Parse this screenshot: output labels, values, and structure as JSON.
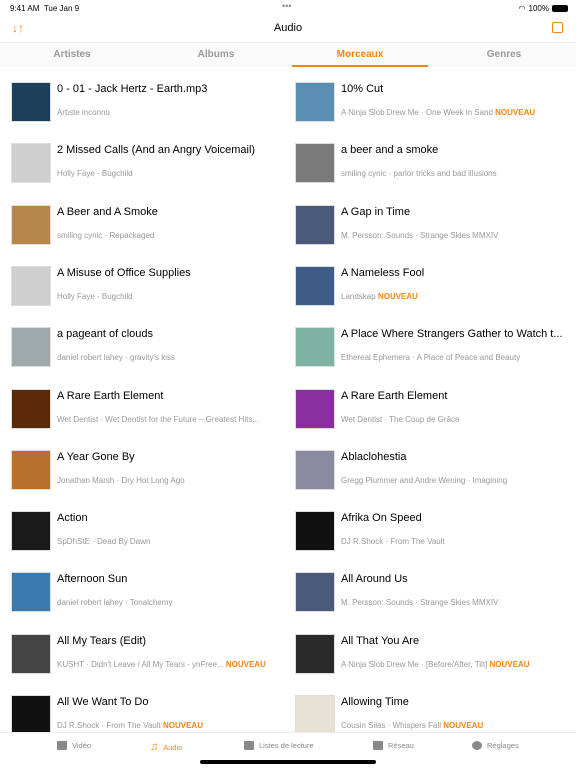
{
  "status": {
    "time": "9:41 AM",
    "date": "Tue Jan 9",
    "battery": "100%"
  },
  "nav": {
    "title": "Audio"
  },
  "segments": [
    {
      "label": "Artistes"
    },
    {
      "label": "Albums"
    },
    {
      "label": "Morceaux",
      "active": true
    },
    {
      "label": "Genres"
    }
  ],
  "new_label": "NOUVEAU",
  "tracks": [
    {
      "title": "0 - 01 - Jack Hertz - Earth.mp3",
      "subtitle": "Artiste inconnu",
      "new": false,
      "thumb": "#1d3f5a"
    },
    {
      "title": "10% Cut",
      "subtitle": "A Ninja Slob Drew Me · One Week in Sand",
      "new": true,
      "thumb": "#5a8fb3"
    },
    {
      "title": "2 Missed Calls (And an Angry Voicemail)",
      "subtitle": "Holly Faye · Bugchild",
      "new": false,
      "thumb": "#cfcfcf"
    },
    {
      "title": "a beer and a smoke",
      "subtitle": "smiling cynic · parlor tricks and bad illusions",
      "new": false,
      "thumb": "#7a7a7a"
    },
    {
      "title": "A Beer and A Smoke",
      "subtitle": "smiling cynic · Repackaged",
      "new": false,
      "thumb": "#b7864b"
    },
    {
      "title": "A Gap in Time",
      "subtitle": "M. Persson: Sounds · Strange Skies MMXIV",
      "new": false,
      "thumb": "#4a5a7a"
    },
    {
      "title": "A Misuse of Office Supplies",
      "subtitle": "Holly Faye · Bugchild",
      "new": false,
      "thumb": "#cfcfcf"
    },
    {
      "title": "A Nameless Fool",
      "subtitle": "Landskap",
      "new": true,
      "thumb": "#3e5c86"
    },
    {
      "title": "a pageant of clouds",
      "subtitle": "daniel robert lahey · gravity's kiss",
      "new": false,
      "thumb": "#9fa8ad"
    },
    {
      "title": "A Place Where Strangers Gather to Watch t...",
      "subtitle": "Ethereal Ephemera · A Place of Peace and Beauty",
      "new": false,
      "thumb": "#7fb3a4"
    },
    {
      "title": "A Rare Earth Element",
      "subtitle": "Wet Dentist · Wet Dentist for the Future – Greatest Hits...",
      "new": false,
      "thumb": "#5a2a0a"
    },
    {
      "title": "A Rare Earth Element",
      "subtitle": "Wet Dentist · The Coup de Grâce",
      "new": false,
      "thumb": "#8a2fa0"
    },
    {
      "title": "A Year Gone By",
      "subtitle": "Jonathan Marsh · Dry Hot Long Ago",
      "new": false,
      "thumb": "#b8702e"
    },
    {
      "title": "Ablaclohestia",
      "subtitle": "Gregg Plummer and Andre Wening · Imagining",
      "new": false,
      "thumb": "#8a8aa0"
    },
    {
      "title": "Action",
      "subtitle": "SpDhStE · Dead By Dawn",
      "new": false,
      "thumb": "#1a1a1a"
    },
    {
      "title": "Afrika On Speed",
      "subtitle": "DJ R.Shock · From The Vault",
      "new": false,
      "thumb": "#111"
    },
    {
      "title": "Afternoon Sun",
      "subtitle": "daniel robert lahey · Tonalchemy",
      "new": false,
      "thumb": "#3a7ab0"
    },
    {
      "title": "All Around Us",
      "subtitle": "M. Persson: Sounds · Strange Skies MMXIV",
      "new": false,
      "thumb": "#4a5a7a"
    },
    {
      "title": "All My Tears (Edit)",
      "subtitle": "KUSHT · Didn't Leave / All My Tears - ynFree...",
      "new": true,
      "thumb": "#444"
    },
    {
      "title": "All That You Are",
      "subtitle": "A Ninja Slob Drew Me · [Before/After, Tilt]",
      "new": true,
      "thumb": "#2a2a2a"
    },
    {
      "title": "All We Want To Do",
      "subtitle": "DJ R.Shock · From The Vault",
      "new": true,
      "thumb": "#111"
    },
    {
      "title": "Allowing Time",
      "subtitle": "Cousin Silas · Whispers Fall",
      "new": true,
      "thumb": "#e8e2d6"
    }
  ],
  "tabs": [
    {
      "label": "Vidéo"
    },
    {
      "label": "Audio",
      "active": true
    },
    {
      "label": "Listes de lecture"
    },
    {
      "label": "Réseau"
    },
    {
      "label": "Réglages"
    }
  ]
}
